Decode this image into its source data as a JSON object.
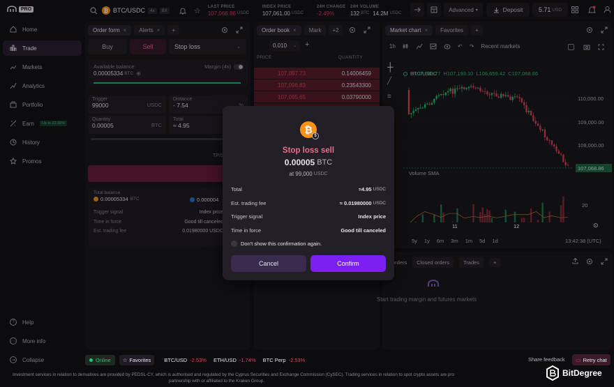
{
  "app": {
    "logo_text": "PRO"
  },
  "topbar": {
    "pair": "BTC/USDC",
    "leverage": "4x",
    "leverage2": "8X",
    "stats": [
      {
        "label": "LAST PRICE",
        "value": "107,068.86",
        "unit": "USDC",
        "color": "#e0445f"
      },
      {
        "label": "INDEX PRICE",
        "value": "107,061.00",
        "unit": "USDC",
        "color": "#e6e3ec"
      },
      {
        "label": "24H CHANGE",
        "value": "-2.49%",
        "unit": "",
        "color": "#e0445f"
      },
      {
        "label": "24H VOLUME",
        "value": "132",
        "unit": "BTC",
        "value2": "14.2M",
        "unit2": "USDC",
        "color": "#e6e3ec"
      }
    ],
    "mode": "Advanced",
    "deposit": "Deposit",
    "balance": "5.71",
    "balance_unit": "USD"
  },
  "sidebar": {
    "items": [
      {
        "label": "Home",
        "icon": "home-icon"
      },
      {
        "label": "Trade",
        "icon": "trade-icon",
        "active": true
      },
      {
        "label": "Markets",
        "icon": "markets-icon"
      },
      {
        "label": "Analytics",
        "icon": "analytics-icon"
      },
      {
        "label": "Portfolio",
        "icon": "portfolio-icon"
      },
      {
        "label": "Earn",
        "icon": "earn-icon",
        "badge": "Up to 22.00%"
      },
      {
        "label": "History",
        "icon": "history-icon"
      },
      {
        "label": "Promos",
        "icon": "promos-icon"
      }
    ],
    "bottom": [
      {
        "label": "Help"
      },
      {
        "label": "More info"
      },
      {
        "label": "Collapse"
      }
    ]
  },
  "order_form": {
    "tabs": [
      "Order form",
      "Alerts"
    ],
    "buy": "Buy",
    "sell": "Sell",
    "order_type": "Stop loss",
    "available_label": "Available balance",
    "available_value": "0.00005334",
    "available_unit": "BTC",
    "margin_label": "Margin (4x)",
    "trigger_label": "Trigger",
    "trigger_value": "99000",
    "trigger_unit": "USDC",
    "distance_label": "Distance",
    "distance_value": "- 7.54",
    "distance_unit": "%",
    "quantity_label": "Quantity",
    "quantity_value": "0.00005",
    "quantity_unit": "BTC",
    "total_label": "Total",
    "total_value": "≈ 4.95",
    "tpsl": "TP/S",
    "total_balance_label": "Total balance",
    "total_balance_value": "0.00005334",
    "total_balance_unit": "BTC",
    "total_balance_value2": "0.000004",
    "rows": [
      {
        "label": "Trigger signal",
        "value": "Index price"
      },
      {
        "label": "Time in force",
        "value": "Good till canceled"
      },
      {
        "label": "Est. trading fee",
        "value": "0.01980000 USDC"
      }
    ]
  },
  "order_book": {
    "tabs": [
      "Order book",
      "Mark"
    ],
    "more": "+2",
    "tick": "0.010",
    "price_header": "PRICE",
    "qty_header": "QUANTITY",
    "asks": [
      {
        "price": "107,097.73",
        "qty": "0.14006459",
        "fill": 1.0
      },
      {
        "price": "107,096.83",
        "qty": "0.23543300",
        "fill": 1.0
      },
      {
        "price": "107,095.65",
        "qty": "0.03790000",
        "fill": 1.0
      },
      {
        "price": "107,095.64",
        "qty": "0.42096204",
        "fill": 1.0
      }
    ]
  },
  "chart": {
    "tabs": [
      "Market chart",
      "Favorites"
    ],
    "interval": "1h",
    "indicators_label": "Recent markets",
    "legend_pair": "BTC/USDC",
    "legend_o": "107,038.77",
    "legend_h": "107,193.10",
    "legend_l": "106,659.42",
    "legend_c": "107,068.86",
    "volume_label": "Volume SMA",
    "volume_value": "9",
    "price_ticks": [
      "110,000.00",
      "109,000.00",
      "108,000.00",
      "107,068.86"
    ],
    "volume_ticks": [
      "20",
      "10"
    ],
    "x_ticks": [
      "11",
      "12"
    ],
    "ranges": [
      "5y",
      "1y",
      "6m",
      "3m",
      "1m",
      "5d",
      "1d"
    ],
    "time": "13:42:38 (UTC)"
  },
  "bottom_panel": {
    "tabs": [
      "orders",
      "Closed orders",
      "Trades"
    ],
    "message": "Start trading margin and futures markets"
  },
  "modal": {
    "title": "Stop loss sell",
    "amount": "0.00005",
    "amount_unit": "BTC",
    "subtitle": "at 99,000",
    "subtitle_unit": "USDC",
    "rows": [
      {
        "label": "Total",
        "value": "≈4.95",
        "unit": "USDC"
      },
      {
        "label": "Est. trading fee",
        "value": "≈ 0.01980000",
        "unit": "USDC"
      },
      {
        "label": "Trigger signal",
        "value": "Index price",
        "unit": ""
      },
      {
        "label": "Time in force",
        "value": "Good till canceled",
        "unit": ""
      }
    ],
    "checkbox_label": "Don't show this confirmation again.",
    "cancel": "Cancel",
    "confirm": "Confirm"
  },
  "statusbar": {
    "online": "Online",
    "favorites": "Favorites",
    "tickers": [
      {
        "pair": "BTC/USD",
        "change": "-2.53%"
      },
      {
        "pair": "ETH/USD",
        "change": "-1.74%"
      },
      {
        "pair": "BTC Perp",
        "change": "-2.53%"
      }
    ],
    "share": "Share feedback",
    "retry": "Retry chat"
  },
  "footer": {
    "text": "Investment services in relation to derivatives are provided by PEDSL-CY, which is authorised and regulated by the Cyprus Securities and Exchange Commission (CySEC). Trading services in relation to spot crypto assets are pro",
    "text2": "partnership with or affiliated to the Kraken Group.",
    "watermark": "BitDegree"
  },
  "colors": {
    "accent": "#7b3ff2",
    "sell_bg": "#e0445f",
    "green": "#27c27a",
    "bg": "#131116"
  }
}
